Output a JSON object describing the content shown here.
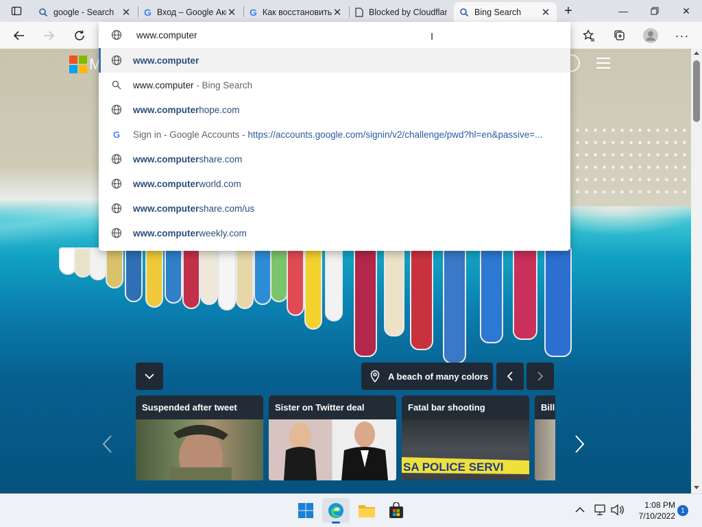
{
  "browser": {
    "tabs": [
      {
        "title": "google - Search",
        "icon": "search-icon"
      },
      {
        "title": "Вход – Google Аккаунты",
        "icon": "google-icon"
      },
      {
        "title": "Как восстановить",
        "icon": "google-icon"
      },
      {
        "title": "Blocked by Cloudflare",
        "icon": "page-icon"
      },
      {
        "title": "Bing Search",
        "icon": "search-icon"
      }
    ],
    "active_tab_index": 4
  },
  "address_bar": {
    "value": "www.computer"
  },
  "suggestions": [
    {
      "icon": "globe-icon",
      "bold": "www.computer",
      "rest": "",
      "suffix": "",
      "url": ""
    },
    {
      "icon": "search-icon",
      "bold": "",
      "rest": "www.computer",
      "suffix": " - Bing Search",
      "url": ""
    },
    {
      "icon": "globe-icon",
      "bold": "www.computer",
      "rest": "hope.com",
      "suffix": "",
      "url": ""
    },
    {
      "icon": "google-icon",
      "bold": "",
      "rest": "",
      "suffix": "Sign in - Google Accounts - ",
      "url": "https://accounts.google.com/signin/v2/challenge/pwd?hl=en&passive=..."
    },
    {
      "icon": "globe-icon",
      "bold": "www.computer",
      "rest": "share.com",
      "suffix": "",
      "url": ""
    },
    {
      "icon": "globe-icon",
      "bold": "www.computer",
      "rest": "world.com",
      "suffix": "",
      "url": ""
    },
    {
      "icon": "globe-icon",
      "bold": "www.computer",
      "rest": "share.com/us",
      "suffix": "",
      "url": ""
    },
    {
      "icon": "globe-icon",
      "bold": "www.computer",
      "rest": "weekly.com",
      "suffix": "",
      "url": ""
    }
  ],
  "bing": {
    "logo_letter": "M",
    "image_caption": "A beach of many colors"
  },
  "news_cards": [
    {
      "title": "Suspended after tweet"
    },
    {
      "title": "Sister on Twitter deal"
    },
    {
      "title": "Fatal bar shooting"
    },
    {
      "title": "Bill"
    }
  ],
  "taskbar": {
    "time": "1:08 PM",
    "date": "7/10/2022",
    "notification_count": "1"
  },
  "colors": {
    "accent": "#3f6ea8",
    "link": "#2b5aa5",
    "card_header": "#222c37"
  }
}
